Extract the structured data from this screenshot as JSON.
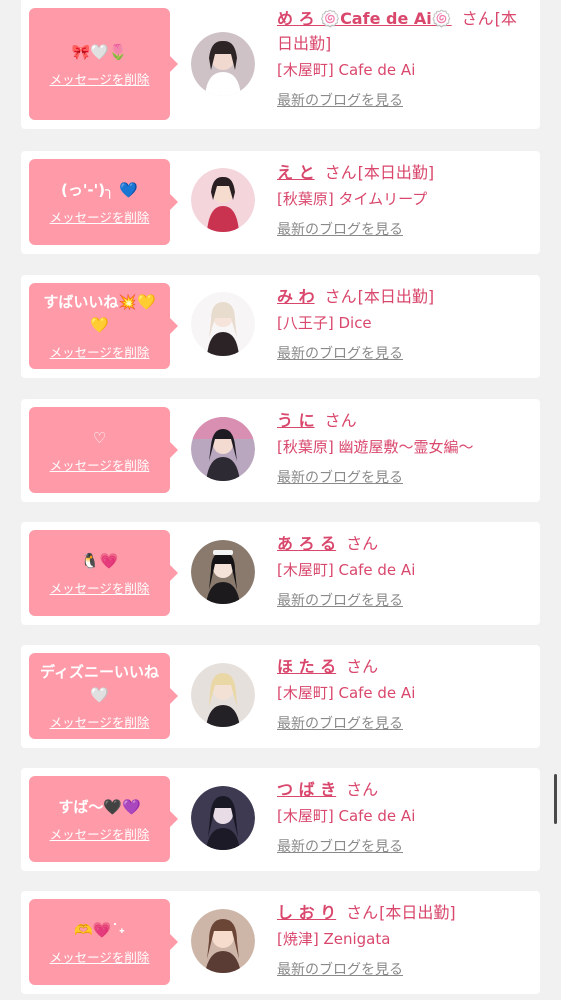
{
  "delete_label": "メッセージを削除",
  "blog_label": "最新のブログを見る",
  "san_label": "さん",
  "colors": {
    "bubble": "#ff9aa8",
    "name": "#d9476c",
    "blog": "#8a8a8a"
  },
  "cards": [
    {
      "message": "🎀🤍🌷",
      "name": "め ろ 🍥Cafe de Ai🍥",
      "status": "[本日出勤]",
      "place": "[木屋町] Cafe de Ai"
    },
    {
      "message": "(っ'-')╮ 💙",
      "name": "え と",
      "status": "[本日出勤]",
      "place": "[秋葉原] タイムリープ"
    },
    {
      "message": "すばいいね💥💛💛",
      "name": "み わ",
      "status": "[本日出勤]",
      "place": "[八王子] Dice"
    },
    {
      "message": "♡",
      "name": "う に",
      "status": "",
      "place": "[秋葉原] 幽遊屋敷〜霊女編〜"
    },
    {
      "message": "🐧💗",
      "name": "あ ろ る",
      "status": "",
      "place": "[木屋町] Cafe de Ai"
    },
    {
      "message": "ディズニーいいね🤍",
      "name": "ほ た る",
      "status": "",
      "place": "[木屋町] Cafe de Ai"
    },
    {
      "message": "すば〜🖤💜",
      "name": "つ ば き",
      "status": "",
      "place": "[木屋町] Cafe de Ai"
    },
    {
      "message": "🫶💗˙˖",
      "name": "し お り",
      "status": "[本日出勤]",
      "place": "[焼津] Zenigata"
    }
  ]
}
